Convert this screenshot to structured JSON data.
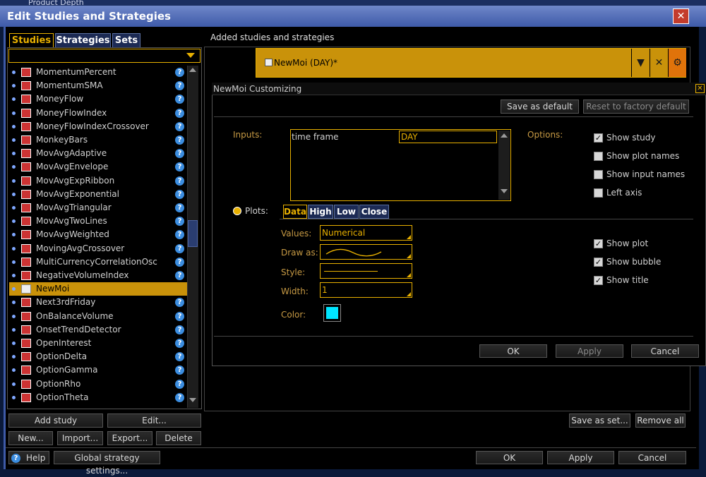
{
  "window": {
    "title": "Edit Studies and Strategies",
    "bg_title": "Product Depth"
  },
  "tabs": {
    "studies": "Studies",
    "strategies": "Strategies",
    "sets": "Sets"
  },
  "studies_list": [
    "MomentumPercent",
    "MomentumSMA",
    "MoneyFlow",
    "MoneyFlowIndex",
    "MoneyFlowIndexCrossover",
    "MonkeyBars",
    "MovAvgAdaptive",
    "MovAvgEnvelope",
    "MovAvgExpRibbon",
    "MovAvgExponential",
    "MovAvgTriangular",
    "MovAvgTwoLines",
    "MovAvgWeighted",
    "MovingAvgCrossover",
    "MultiCurrencyCorrelationOsc",
    "NegativeVolumeIndex",
    "NewMoi",
    "Next3rdFriday",
    "OnBalanceVolume",
    "OnsetTrendDetector",
    "OpenInterest",
    "OptionDelta",
    "OptionGamma",
    "OptionRho",
    "OptionTheta"
  ],
  "selected_study": "NewMoi",
  "left_buttons": {
    "add_study": "Add study",
    "edit": "Edit...",
    "new": "New...",
    "import": "Import...",
    "export": "Export...",
    "delete": "Delete"
  },
  "right": {
    "header": "Added studies and strategies",
    "added_study": "NewMoi (DAY)*"
  },
  "customizing": {
    "title": "NewMoi Customizing",
    "save_default": "Save as default",
    "reset_default": "Reset to factory default",
    "inputs_label": "Inputs:",
    "input_name": "time frame",
    "input_value": "DAY",
    "options_label": "Options:",
    "options": [
      {
        "label": "Show study",
        "checked": true
      },
      {
        "label": "Show plot names",
        "checked": false
      },
      {
        "label": "Show input names",
        "checked": false
      },
      {
        "label": "Left axis",
        "checked": false
      }
    ],
    "plots_label": "Plots:",
    "plot_tabs": [
      "Data",
      "High",
      "Low",
      "Close"
    ],
    "fields": {
      "values_label": "Values:",
      "values": "Numerical",
      "drawas_label": "Draw as:",
      "style_label": "Style:",
      "width_label": "Width:",
      "width": "1",
      "color_label": "Color:",
      "color": "#00e5ff"
    },
    "plot_options": [
      {
        "label": "Show plot",
        "checked": true
      },
      {
        "label": "Show bubble",
        "checked": true
      },
      {
        "label": "Show title",
        "checked": true
      }
    ],
    "ok": "OK",
    "apply": "Apply",
    "cancel": "Cancel"
  },
  "bottom": {
    "save_as_set": "Save as set...",
    "remove_all": "Remove all",
    "help": "Help",
    "global": "Global strategy settings...",
    "ok": "OK",
    "apply": "Apply",
    "cancel": "Cancel"
  }
}
